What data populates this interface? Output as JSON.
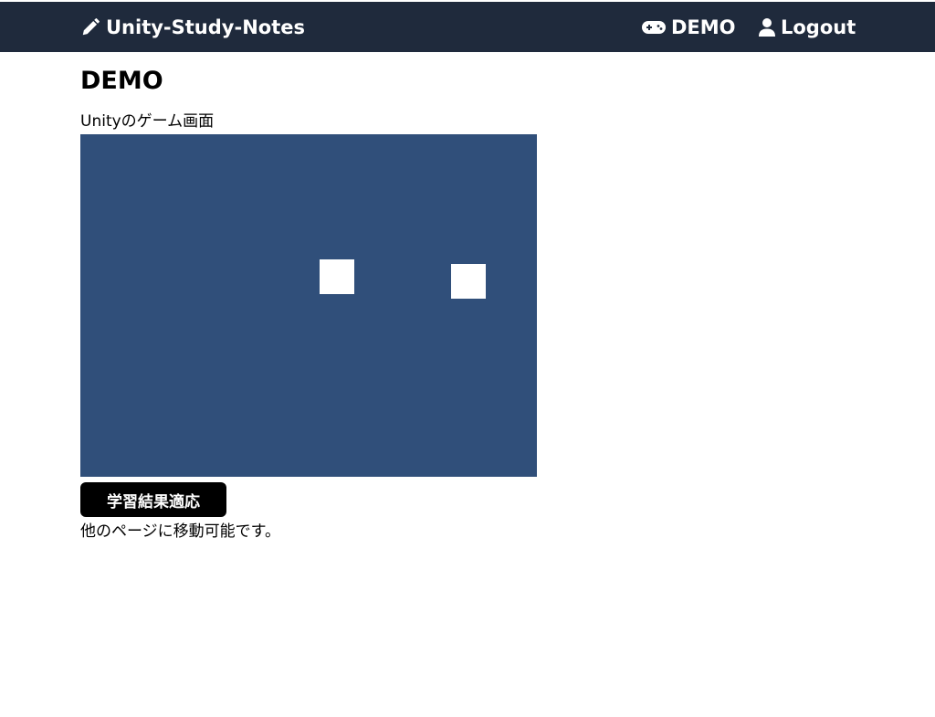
{
  "navbar": {
    "brand_label": "Unity-Study-Notes",
    "brand_icon": "pencil-icon",
    "links": [
      {
        "label": "DEMO",
        "icon": "gamepad-icon"
      },
      {
        "label": "Logout",
        "icon": "user-icon"
      }
    ],
    "background_color": "#1f2a3c"
  },
  "main": {
    "title": "DEMO",
    "game_caption": "Unityのゲーム画面",
    "game_background_color": "#304f7a",
    "apply_button_label": "学習結果適応",
    "note": "他のページに移動可能です。"
  }
}
